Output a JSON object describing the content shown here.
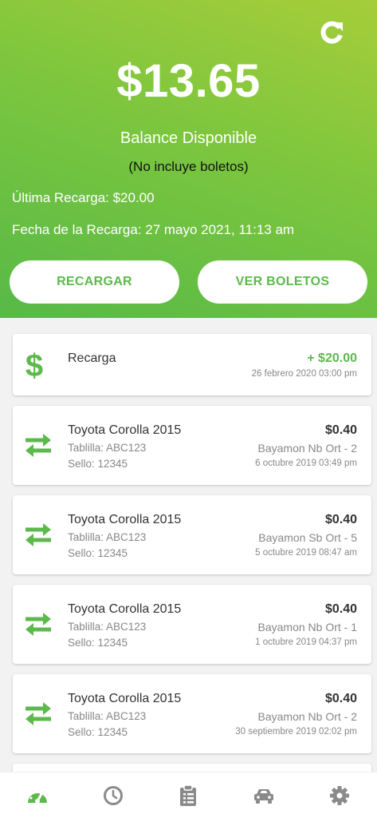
{
  "header": {
    "balance": "$13.65",
    "balance_label": "Balance Disponible",
    "note": "(No incluye boletos)",
    "last_recharge": "Última Recarga: $20.00",
    "recharge_date": "Fecha de la Recarga: 27 mayo 2021, 11:13 am",
    "recharge_button": "RECARGAR",
    "tickets_button": "VER BOLETOS"
  },
  "transactions": [
    {
      "type": "recharge",
      "icon": "dollar-icon",
      "title": "Recarga",
      "amount": "+ $20.00",
      "date": "26 febrero 2020 03:00 pm"
    },
    {
      "type": "toll",
      "icon": "swap-arrows-icon",
      "title": "Toyota Corolla 2015",
      "plate": "Tablilla: ABC123",
      "seal": "Sello: 12345",
      "amount": "$0.40",
      "route": "Bayamon Nb Ort - 2",
      "date": "6 octubre 2019 03:49 pm"
    },
    {
      "type": "toll",
      "icon": "swap-arrows-icon",
      "title": "Toyota Corolla 2015",
      "plate": "Tablilla: ABC123",
      "seal": "Sello: 12345",
      "amount": "$0.40",
      "route": "Bayamon Sb Ort - 5",
      "date": "5 octubre 2019 08:47 am"
    },
    {
      "type": "toll",
      "icon": "swap-arrows-icon",
      "title": "Toyota Corolla 2015",
      "plate": "Tablilla: ABC123",
      "seal": "Sello: 12345",
      "amount": "$0.40",
      "route": "Bayamon Nb Ort - 1",
      "date": "1 octubre 2019 04:37 pm"
    },
    {
      "type": "toll",
      "icon": "swap-arrows-icon",
      "title": "Toyota Corolla 2015",
      "plate": "Tablilla: ABC123",
      "seal": "Sello: 12345",
      "amount": "$0.40",
      "route": "Bayamon Nb Ort - 2",
      "date": "30 septiembre 2019 02:02 pm"
    }
  ],
  "nav": [
    "dashboard-icon",
    "clock-icon",
    "clipboard-icon",
    "car-icon",
    "gear-icon"
  ],
  "colors": {
    "accent": "#5cb94b",
    "header_start": "#57b947",
    "header_end": "#a6cd3a",
    "active_nav": "#5cb94b",
    "inactive_nav": "#8a8a8a"
  }
}
